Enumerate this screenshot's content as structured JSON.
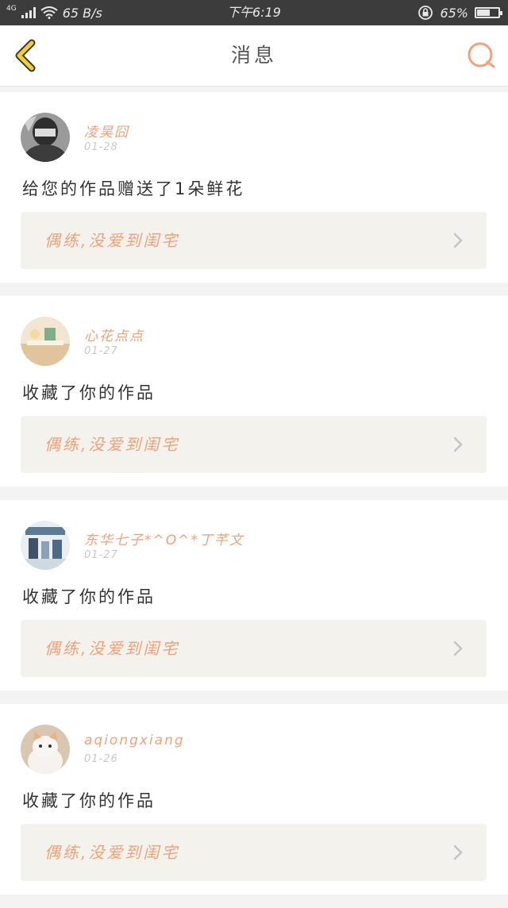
{
  "status_bar": {
    "network_type": "4G",
    "speed": "65 B/s",
    "time": "下午6:19",
    "battery": "65%",
    "battery_level": 0.65
  },
  "header": {
    "title": "消息",
    "back_icon": "back-chevron-icon",
    "search_icon": "search-icon"
  },
  "accent_color": "#f0a27a",
  "back_icon_color": "#f2cf3a",
  "messages": [
    {
      "username": "凌昊囧",
      "date": "01-28",
      "text": "给您的作品赠送了1朵鲜花",
      "work_title": "偶练,没爱到闺宅"
    },
    {
      "username": "心花点点",
      "date": "01-27",
      "text": "收藏了你的作品",
      "work_title": "偶练,没爱到闺宅"
    },
    {
      "username": "东华七子*^O^*丁芊文",
      "date": "01-27",
      "text": "收藏了你的作品",
      "work_title": "偶练,没爱到闺宅"
    },
    {
      "username": "aqiongxiang",
      "date": "01-26",
      "text": "收藏了你的作品",
      "work_title": "偶练,没爱到闺宅"
    }
  ]
}
